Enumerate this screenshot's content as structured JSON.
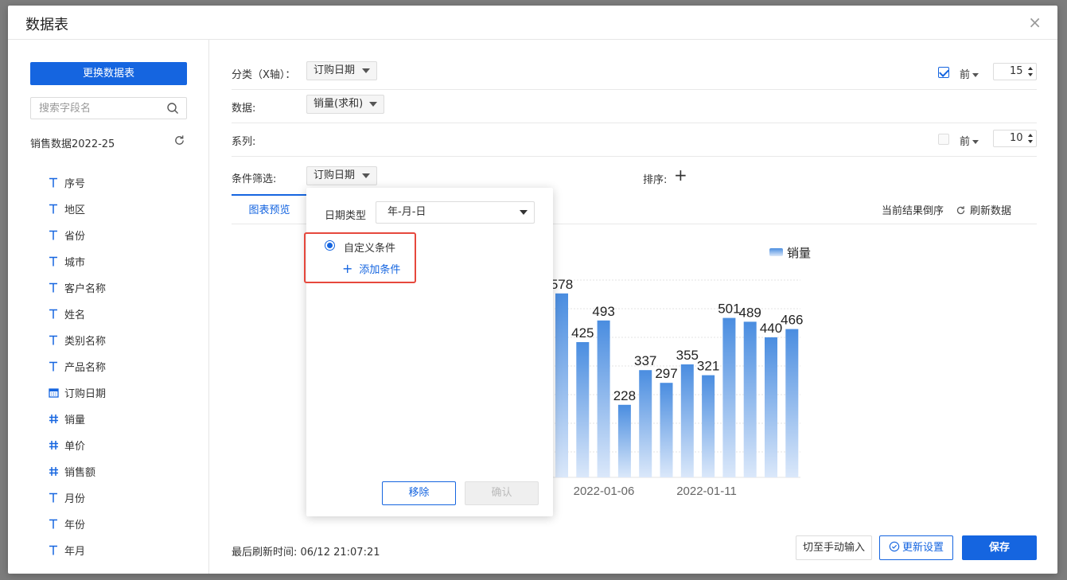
{
  "dialog": {
    "title": "数据表",
    "close": "×"
  },
  "left": {
    "change_btn": "更换数据表",
    "search_placeholder": "搜索字段名",
    "dataset_name": "销售数据2022-25",
    "fields": [
      {
        "label": "序号",
        "type": "text"
      },
      {
        "label": "地区",
        "type": "text"
      },
      {
        "label": "省份",
        "type": "text"
      },
      {
        "label": "城市",
        "type": "text"
      },
      {
        "label": "客户名称",
        "type": "text"
      },
      {
        "label": "姓名",
        "type": "text"
      },
      {
        "label": "类别名称",
        "type": "text"
      },
      {
        "label": "产品名称",
        "type": "text"
      },
      {
        "label": "订购日期",
        "type": "date"
      },
      {
        "label": "销量",
        "type": "number"
      },
      {
        "label": "单价",
        "type": "number"
      },
      {
        "label": "销售额",
        "type": "number"
      },
      {
        "label": "月份",
        "type": "text"
      },
      {
        "label": "年份",
        "type": "text"
      },
      {
        "label": "年月",
        "type": "text"
      }
    ]
  },
  "config": {
    "category_label": "分类（X轴）：",
    "category_value": "订购日期",
    "data_label": "数据:",
    "data_value": "销量(求和)",
    "series_label": "系列:",
    "filter_label": "条件筛选:",
    "filter_value": "订购日期",
    "sort_label": "排序:",
    "top_label": "前",
    "top_n_category": "15",
    "top_n_series": "10",
    "category_top_checked": true,
    "series_top_checked": false
  },
  "tabs": {
    "preview": "图表预览",
    "reverse": "当前结果倒序",
    "refresh": "刷新数据"
  },
  "chart_data": {
    "type": "bar",
    "legend": "销量",
    "values": [
      578,
      425,
      493,
      228,
      337,
      297,
      355,
      321,
      501,
      489,
      440,
      466
    ],
    "x_tick_labels": [
      "2022-01-06",
      "2022-01-11"
    ],
    "ylim": [
      0,
      700
    ],
    "bar_color": "#4a8de0"
  },
  "popup": {
    "date_type_label": "日期类型",
    "date_type_value": "年-月-日",
    "custom_condition": "自定义条件",
    "add_condition": "添加条件",
    "remove": "移除",
    "confirm": "确认"
  },
  "footer": {
    "last_refresh": "最后刷新时间: 06/12 21:07:21",
    "manual_input": "切至手动输入",
    "update_settings": "更新设置",
    "save": "保存"
  },
  "colors": {
    "primary": "#1565e0",
    "highlight_border": "#e6483d"
  }
}
